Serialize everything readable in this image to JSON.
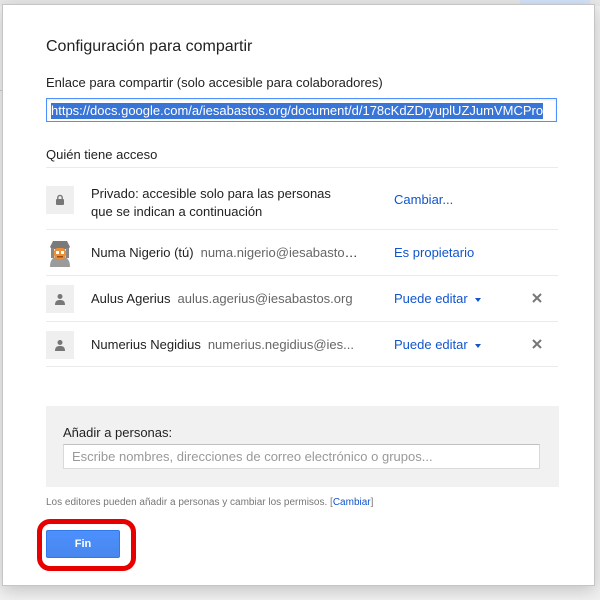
{
  "dialog": {
    "title": "Configuración para compartir",
    "link_label": "Enlace para compartir (solo accesible para colaboradores)",
    "link_value": "https://docs.google.com/a/iesabastos.org/document/d/178cKdZDryuplUZJumVMCPro",
    "access_label": "Quién tiene acceso",
    "rows": [
      {
        "icon": "lock-icon",
        "text": "Privado: accesible solo para las personas que se indican a continuación",
        "action": "Cambiar..."
      },
      {
        "icon": "owner-avatar",
        "name": "Numa Nigerio (tú)",
        "email": "numa.nigerio@iesabastos...",
        "action": "Es propietario"
      },
      {
        "icon": "person-icon",
        "name": "Aulus Agerius",
        "email": "aulus.agerius@iesabastos.org",
        "action": "Puede editar",
        "removable": true
      },
      {
        "icon": "person-icon",
        "name": "Numerius Negidius",
        "email": "numerius.negidius@ies...",
        "action": "Puede editar",
        "removable": true
      }
    ],
    "add_people": {
      "label": "Añadir a personas:",
      "placeholder": "Escribe nombres, direcciones de correo electrónico o grupos...",
      "value": ""
    },
    "footnote": {
      "text": "Los editores pueden añadir a personas y cambiar los permisos.",
      "link": "Cambiar"
    },
    "done_button": "Fin"
  },
  "colors": {
    "link": "#1155cc",
    "primary_button": "#4d90fe",
    "highlight": "#e60000"
  }
}
